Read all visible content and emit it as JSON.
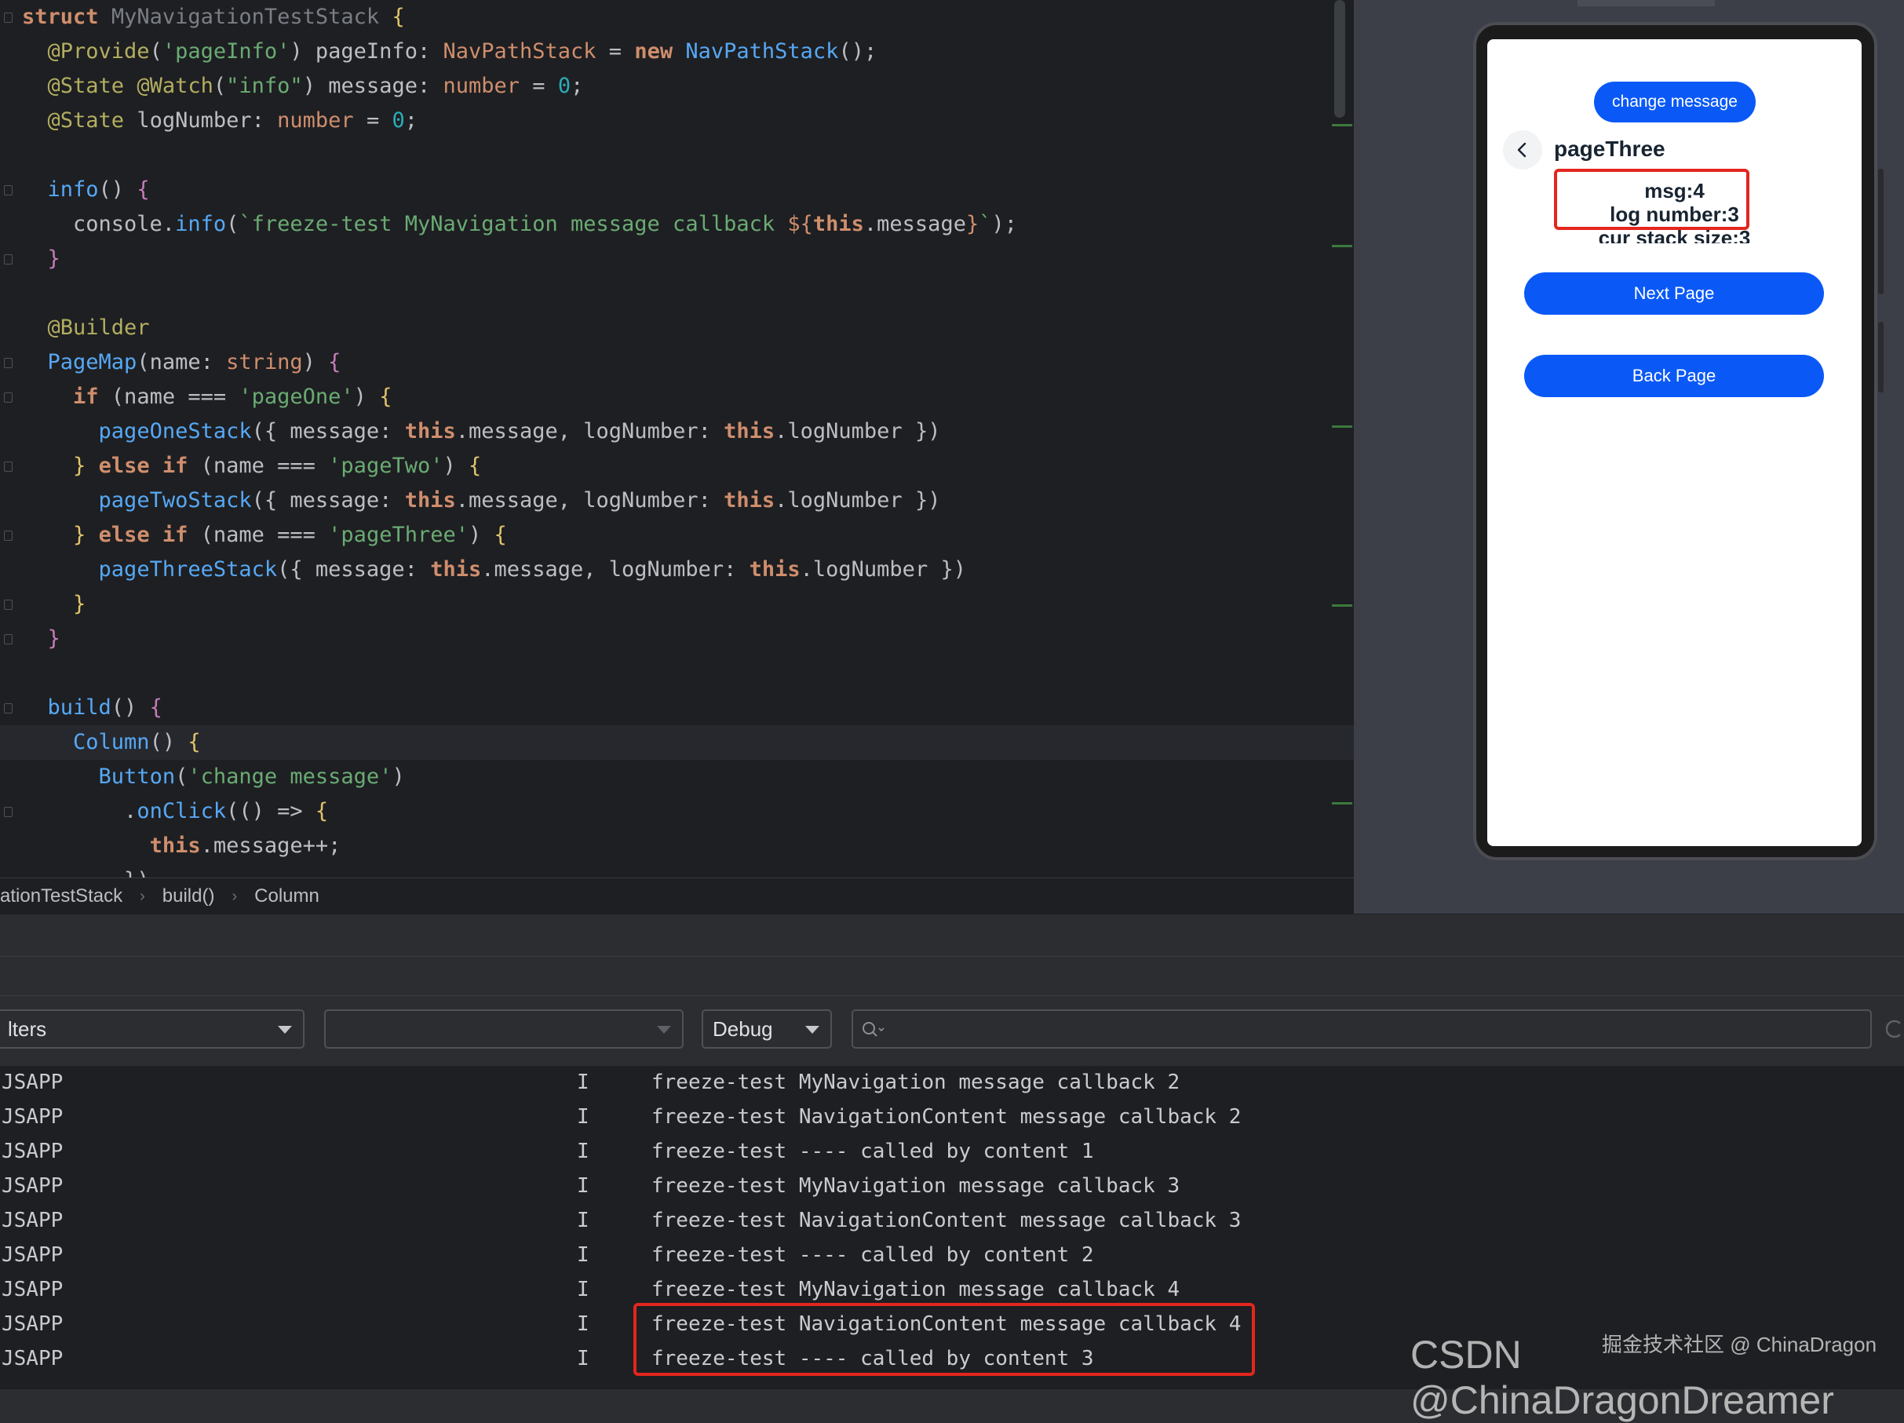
{
  "editor": {
    "lines": [
      "<span class='kw'>struct</span> <span class='dim'>MyNavigationTestStack</span> <span class='brace1'>{</span>",
      "  <span class='dec'>@Provide</span>(<span class='str'>'pageInfo'</span>) pageInfo: <span class='ty'>NavPathStack</span> = <span class='kw'>new</span> <span class='cls'>NavPathStack</span>();",
      "  <span class='dec'>@State</span> <span class='dec'>@Watch</span>(<span class='str'>\"info\"</span>) message: <span class='ty'>number</span> = <span class='num'>0</span>;",
      "  <span class='dec'>@State</span> logNumber: <span class='ty'>number</span> = <span class='num'>0</span>;",
      "",
      "  <span class='fn'>info</span>() <span class='purple'>{</span>",
      "    console.<span class='fn'>info</span>(<span class='str'>`freeze-test MyNavigation message callback </span><span class='kwp'>${</span><span class='kw'>this</span>.message<span class='kwp'>}</span><span class='str'>`</span>);",
      "  <span class='purple'>}</span>",
      "",
      "  <span class='dec'>@Builder</span>",
      "  <span class='fn'>PageMap</span>(name: <span class='ty'>string</span>) <span class='purple'>{</span>",
      "    <span class='kw'>if</span> (name === <span class='str'>'pageOne'</span>) <span class='brace1'>{</span>",
      "      <span class='fn'>pageOneStack</span>({ message: <span class='kw'>this</span>.message, logNumber: <span class='kw'>this</span>.logNumber })",
      "    <span class='brace1'>}</span> <span class='kw'>else if</span> (name === <span class='str'>'pageTwo'</span>) <span class='brace1'>{</span>",
      "      <span class='fn'>pageTwoStack</span>({ message: <span class='kw'>this</span>.message, logNumber: <span class='kw'>this</span>.logNumber })",
      "    <span class='brace1'>}</span> <span class='kw'>else if</span> (name === <span class='str'>'pageThree'</span>) <span class='brace1'>{</span>",
      "      <span class='fn'>pageThreeStack</span>({ message: <span class='kw'>this</span>.message, logNumber: <span class='kw'>this</span>.logNumber })",
      "    <span class='brace1'>}</span>",
      "  <span class='purple'>}</span>",
      "",
      "  <span class='fn'>build</span>() <span class='purple'>{</span>",
      "    <span class='fn'>Column</span>() <span class='brace1'>{</span>",
      "      <span class='fn'>Button</span>(<span class='str'>'change message'</span>)",
      "        .<span class='fn'>onClick</span>(() => <span class='brace1'>{</span>",
      "          <span class='kw'>this</span>.message++;",
      "        })"
    ],
    "current_line": 21
  },
  "breadcrumb": [
    "ationTestStack",
    "build()",
    "Column"
  ],
  "preview": {
    "change_button": "change message",
    "title": "pageThree",
    "msg": "msg:4",
    "log_number": "log number:3",
    "stack_size": "cur stack size:3",
    "next_button": "Next Page",
    "back_button": "Back Page",
    "back_icon": "chevron-left-icon"
  },
  "log": {
    "filters_label": "lters",
    "level": "Debug",
    "rows": [
      {
        "tag": "JSAPP",
        "level": "I",
        "message": "freeze-test MyNavigation message callback 2"
      },
      {
        "tag": "JSAPP",
        "level": "I",
        "message": "freeze-test NavigationContent message callback 2"
      },
      {
        "tag": "JSAPP",
        "level": "I",
        "message": "freeze-test ---- called by content 1"
      },
      {
        "tag": "JSAPP",
        "level": "I",
        "message": "freeze-test MyNavigation message callback 3"
      },
      {
        "tag": "JSAPP",
        "level": "I",
        "message": "freeze-test NavigationContent message callback 3"
      },
      {
        "tag": "JSAPP",
        "level": "I",
        "message": "freeze-test ---- called by content 2"
      },
      {
        "tag": "JSAPP",
        "level": "I",
        "message": "freeze-test MyNavigation message callback 4"
      },
      {
        "tag": "JSAPP",
        "level": "I",
        "message": "freeze-test NavigationContent message callback 4"
      },
      {
        "tag": "JSAPP",
        "level": "I",
        "message": "freeze-test ---- called by content 3"
      }
    ]
  },
  "watermark": {
    "small": "掘金技术社区 @ ChinaDragon",
    "large": "CSDN @ChinaDragonDreamer"
  },
  "colors": {
    "accent_blue": "#0a59f7",
    "highlight_red": "#e3261e"
  }
}
